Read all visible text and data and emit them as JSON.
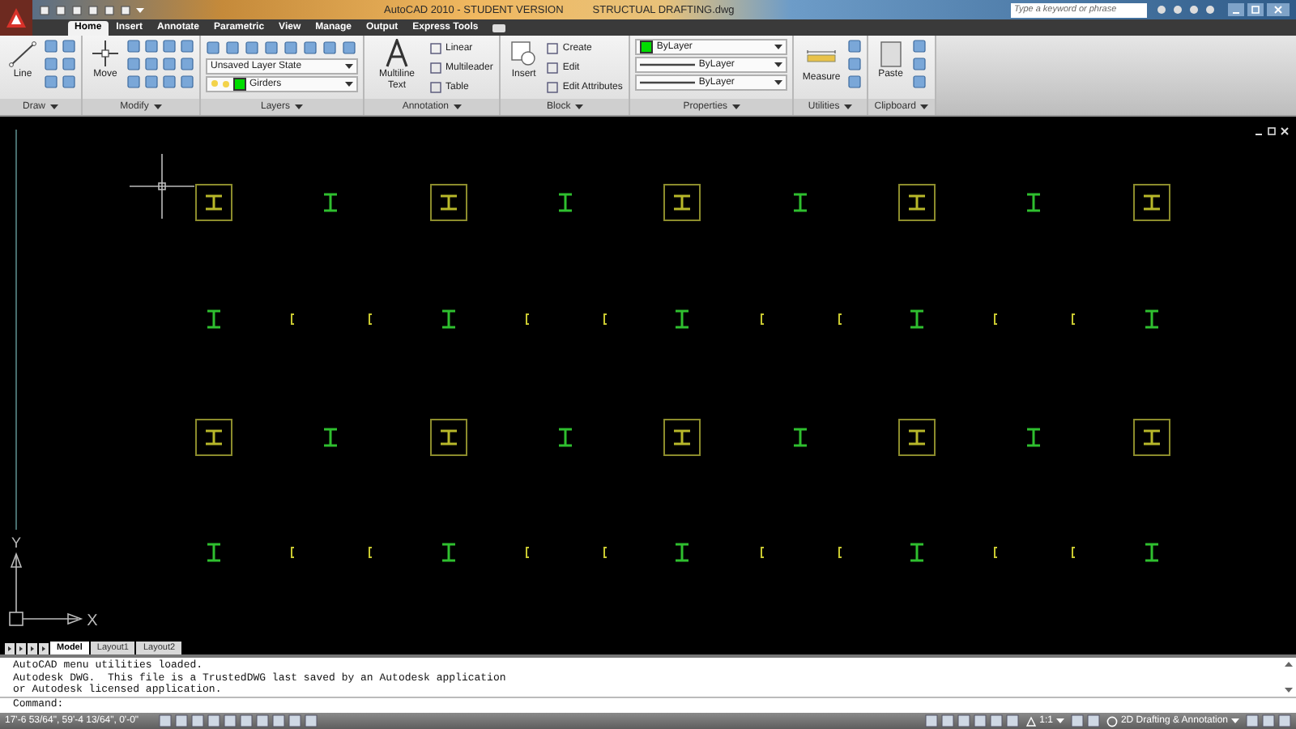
{
  "title_bar": {
    "app_title": "AutoCAD 2010 - STUDENT VERSION",
    "file_name": "STRUCTUAL DRAFTING.dwg",
    "search": {
      "placeholder": "Type a keyword or phrase"
    }
  },
  "ribbon_tabs": [
    {
      "label": "Home",
      "selected": true
    },
    {
      "label": "Insert",
      "selected": false
    },
    {
      "label": "Annotate",
      "selected": false
    },
    {
      "label": "Parametric",
      "selected": false
    },
    {
      "label": "View",
      "selected": false
    },
    {
      "label": "Manage",
      "selected": false
    },
    {
      "label": "Output",
      "selected": false
    },
    {
      "label": "Express Tools",
      "selected": false
    }
  ],
  "ribbon_panels": [
    {
      "title": "Draw",
      "columns": [
        {
          "kind": "large",
          "label": "Line"
        },
        {
          "kind": "icon_column"
        },
        {
          "kind": "icon_column"
        }
      ]
    },
    {
      "title": "Modify",
      "columns": [
        {
          "kind": "large",
          "label": "Move"
        },
        {
          "kind": "icon_column"
        },
        {
          "kind": "icon_column"
        },
        {
          "kind": "icon_column"
        },
        {
          "kind": "icon_column"
        }
      ]
    },
    {
      "title": "Layers",
      "columns": [
        {
          "kind": "stack",
          "rows": [
            {
              "kind": "icon_strip"
            },
            {
              "kind": "state_dropdown",
              "value": "Unsaved Layer State"
            },
            {
              "kind": "layer_dropdown",
              "value": "Girders",
              "color": "#00dd00"
            }
          ]
        }
      ]
    },
    {
      "title": "Annotation",
      "columns": [
        {
          "kind": "large",
          "label": "Multiline Text"
        },
        {
          "kind": "stack",
          "rows": [
            {
              "kind": "small",
              "label": "Linear"
            },
            {
              "kind": "small",
              "label": "Multileader"
            },
            {
              "kind": "small",
              "label": "Table"
            }
          ]
        }
      ]
    },
    {
      "title": "Block",
      "columns": [
        {
          "kind": "large",
          "label": "Insert"
        },
        {
          "kind": "stack",
          "rows": [
            {
              "kind": "small",
              "label": "Create"
            },
            {
              "kind": "small",
              "label": "Edit"
            },
            {
              "kind": "small",
              "label": "Edit Attributes"
            }
          ]
        }
      ]
    },
    {
      "title": "Properties",
      "columns": [
        {
          "kind": "stack",
          "rows": [
            {
              "kind": "color_dropdown",
              "value": "ByLayer",
              "color": "#00dd00"
            },
            {
              "kind": "linetype_dropdown",
              "value": "ByLayer"
            },
            {
              "kind": "linetype_dropdown",
              "value": "ByLayer"
            }
          ]
        }
      ]
    },
    {
      "title": "Utilities",
      "columns": [
        {
          "kind": "large",
          "label": "Measure"
        },
        {
          "kind": "icon_column"
        }
      ]
    },
    {
      "title": "Clipboard",
      "columns": [
        {
          "kind": "large",
          "label": "Paste"
        },
        {
          "kind": "icon_column"
        }
      ]
    }
  ],
  "drawing": {
    "ucs": {
      "y_label": "Y",
      "x_label": "X"
    }
  },
  "layout_tabs": [
    {
      "label": "Model",
      "selected": true
    },
    {
      "label": "Layout1",
      "selected": false
    },
    {
      "label": "Layout2",
      "selected": false
    }
  ],
  "command_history": [
    "AutoCAD menu utilities loaded.",
    "Autodesk DWG.  This file is a TrustedDWG last saved by an Autodesk application",
    "or Autodesk licensed application."
  ],
  "command_prompt": "Command:",
  "status_bar": {
    "coordinates": "17'-6 53/64\", 59'-4 13/64\", 0'-0\"",
    "annotation_scale": "1:1",
    "workspace": "2D Drafting & Annotation"
  }
}
